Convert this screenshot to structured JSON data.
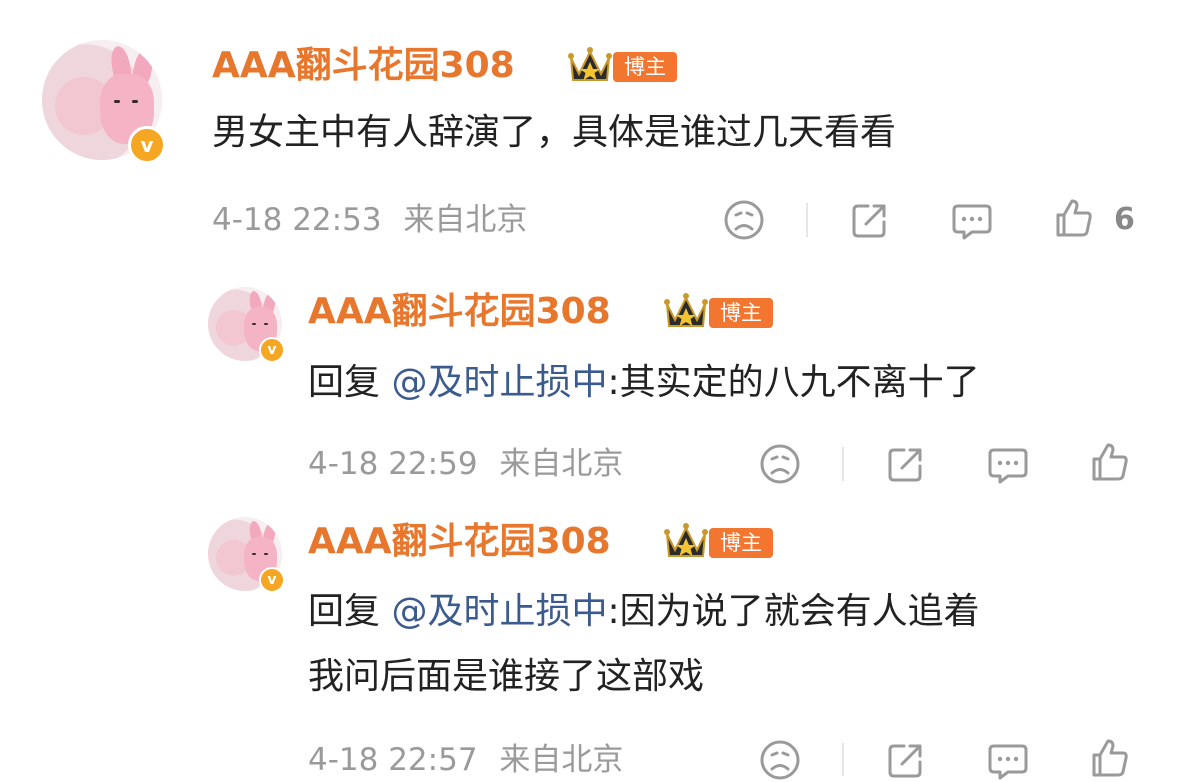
{
  "comments": [
    {
      "username": "AAA翻斗花园308",
      "badge": "博主",
      "text": "男女主中有人辞演了，具体是谁过几天看看",
      "time": "4-18 22:53",
      "location": "来自北京",
      "like_count": "6"
    },
    {
      "username": "AAA翻斗花园308",
      "badge": "博主",
      "reply_prefix": "回复 ",
      "mention": "@及时止损中",
      "text": ":其实定的八九不离十了",
      "time": "4-18 22:59",
      "location": "来自北京",
      "like_count": ""
    },
    {
      "username": "AAA翻斗花园308",
      "badge": "博主",
      "reply_prefix": "回复 ",
      "mention": "@及时止损中",
      "text": ":因为说了就会有人追着",
      "text_line2": "我问后面是谁接了这部戏",
      "time": "4-18 22:57",
      "location": "来自北京",
      "like_count": ""
    }
  ],
  "colors": {
    "username": "#e8772e",
    "badge_bg": "#f2762f",
    "mention": "#3b5b8f",
    "meta": "#9a9a9a",
    "vip": "#f5a623"
  },
  "icons": [
    "sad-face-icon",
    "share-icon",
    "comment-icon",
    "like-icon",
    "crown-icon",
    "verified-icon"
  ]
}
